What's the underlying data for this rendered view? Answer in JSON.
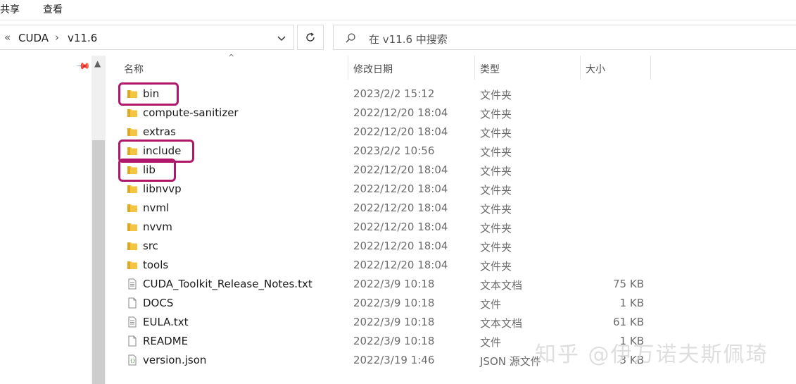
{
  "ribbon": {
    "tab_share": "共享",
    "tab_view": "查看"
  },
  "address": {
    "overflow": "«",
    "crumb1": "CUDA",
    "sep": "›",
    "crumb2": "v11.6",
    "dropdown_icon": "chevron-down-icon",
    "refresh_icon": "refresh-icon"
  },
  "search": {
    "placeholder": "在 v11.6 中搜索",
    "icon": "search-icon"
  },
  "columns": {
    "name": "名称",
    "date": "修改日期",
    "type": "类型",
    "size": "大小"
  },
  "files": [
    {
      "name": "bin",
      "date": "2023/2/2 15:12",
      "type": "文件夹",
      "size": "",
      "icon": "folder-icon",
      "highlighted": true
    },
    {
      "name": "compute-sanitizer",
      "date": "2022/12/20 18:04",
      "type": "文件夹",
      "size": "",
      "icon": "folder-icon",
      "highlighted": false
    },
    {
      "name": "extras",
      "date": "2022/12/20 18:04",
      "type": "文件夹",
      "size": "",
      "icon": "folder-icon",
      "highlighted": false
    },
    {
      "name": "include",
      "date": "2023/2/2 10:56",
      "type": "文件夹",
      "size": "",
      "icon": "folder-icon",
      "highlighted": true
    },
    {
      "name": "lib",
      "date": "2022/12/20 18:04",
      "type": "文件夹",
      "size": "",
      "icon": "folder-icon",
      "highlighted": true
    },
    {
      "name": "libnvvp",
      "date": "2022/12/20 18:04",
      "type": "文件夹",
      "size": "",
      "icon": "folder-icon",
      "highlighted": false
    },
    {
      "name": "nvml",
      "date": "2022/12/20 18:04",
      "type": "文件夹",
      "size": "",
      "icon": "folder-icon",
      "highlighted": false
    },
    {
      "name": "nvvm",
      "date": "2022/12/20 18:04",
      "type": "文件夹",
      "size": "",
      "icon": "folder-icon",
      "highlighted": false
    },
    {
      "name": "src",
      "date": "2022/12/20 18:04",
      "type": "文件夹",
      "size": "",
      "icon": "folder-icon",
      "highlighted": false
    },
    {
      "name": "tools",
      "date": "2022/12/20 18:04",
      "type": "文件夹",
      "size": "",
      "icon": "folder-icon",
      "highlighted": false
    },
    {
      "name": "CUDA_Toolkit_Release_Notes.txt",
      "date": "2022/3/9 10:18",
      "type": "文本文档",
      "size": "75 KB",
      "icon": "text-file-icon",
      "highlighted": false
    },
    {
      "name": "DOCS",
      "date": "2022/3/9 10:18",
      "type": "文件",
      "size": "1 KB",
      "icon": "file-icon",
      "highlighted": false
    },
    {
      "name": "EULA.txt",
      "date": "2022/3/9 10:18",
      "type": "文本文档",
      "size": "61 KB",
      "icon": "text-file-icon",
      "highlighted": false
    },
    {
      "name": "README",
      "date": "2022/3/9 10:18",
      "type": "文件",
      "size": "1 KB",
      "icon": "file-icon",
      "highlighted": false
    },
    {
      "name": "version.json",
      "date": "2022/3/19 1:46",
      "type": "JSON 源文件",
      "size": "3 KB",
      "icon": "json-file-icon",
      "highlighted": false
    }
  ],
  "watermark": "知乎 @伊万诺夫斯佩琦",
  "colors": {
    "highlight": "#b0176a",
    "folder": "#f4c542"
  }
}
